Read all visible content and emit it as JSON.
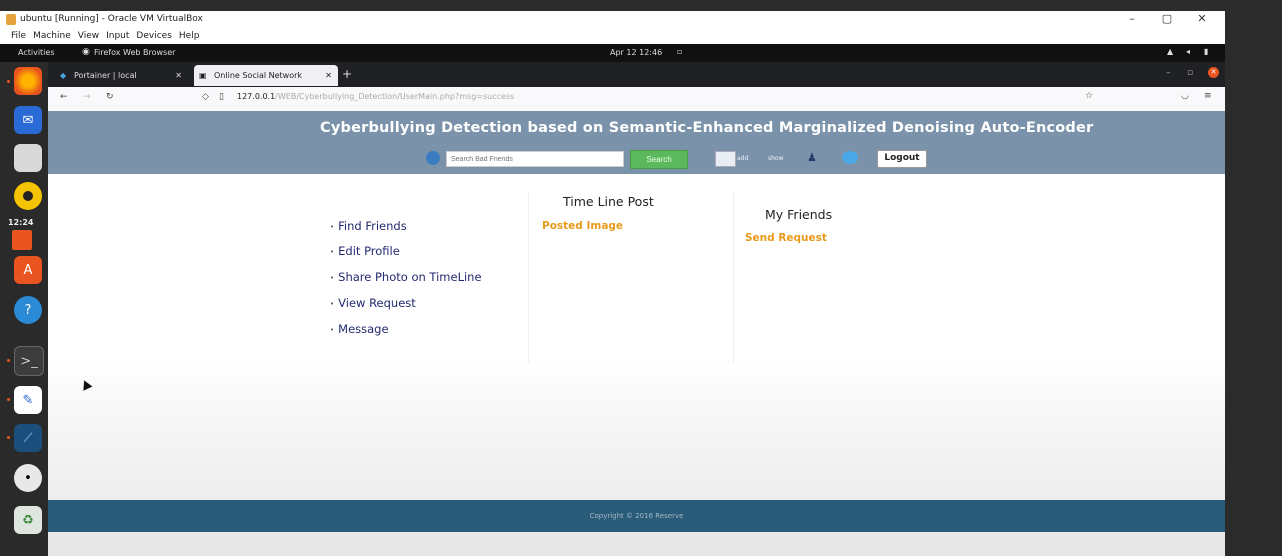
{
  "vbox": {
    "title": "ubuntu [Running] - Oracle VM VirtualBox",
    "menu": [
      "File",
      "Machine",
      "View",
      "Input",
      "Devices",
      "Help"
    ],
    "controls": {
      "minimize": "–",
      "restore": "▢",
      "close": "✕"
    }
  },
  "gnome": {
    "activities": "Activities",
    "app_name": "Firefox Web Browser",
    "clock": "Apr 12  12:46",
    "dock_clock": "12:24"
  },
  "browser": {
    "tabs": [
      {
        "label": "Portainer | local",
        "active": false
      },
      {
        "label": "Online Social Network",
        "active": true
      }
    ],
    "new_tab": "+",
    "url_host": "127.0.0.1",
    "url_rest": "/WEB/Cyberbullying_Detection/UserMain.php?msg=success"
  },
  "page": {
    "title": "Cyberbullying Detection based on Semantic-Enhanced Marginalized Denoising Auto-Encoder",
    "search_placeholder": "Search Bad Friends",
    "search_button": "Search",
    "header_links": [
      "add",
      "show"
    ],
    "logout": "Logout",
    "menu": [
      "Find Friends",
      "Edit Profile",
      "Share Photo on TimeLine",
      "View Request",
      "Message"
    ],
    "timeline_title": "Time Line Post",
    "timeline_link": "Posted Image",
    "friends_title": "My Friends",
    "friends_link": "Send Request",
    "footer": "Copyright © 2016 Reserve"
  },
  "colors": {
    "header_bg": "#7b93aa",
    "footer_bg": "#2a5b78",
    "accent_orange": "#e89a1a",
    "link_navy": "#222a6e",
    "search_green": "#5cb85c"
  }
}
